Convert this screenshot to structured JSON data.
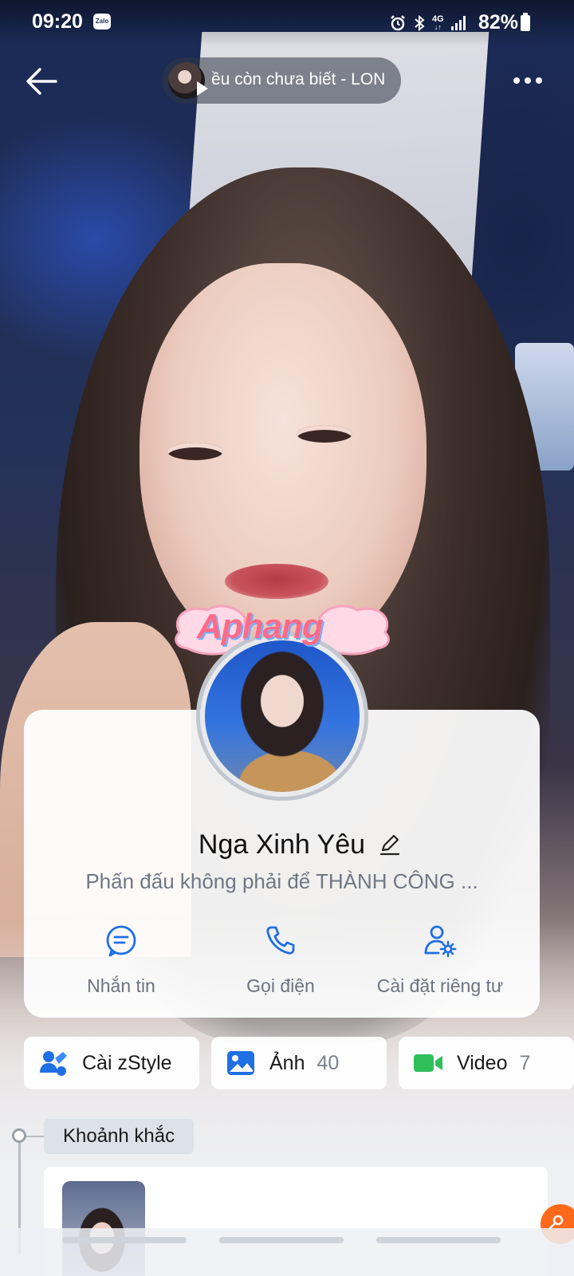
{
  "status_bar": {
    "time": "09:20",
    "app_badge": "Zalo",
    "network": "4G",
    "battery": "82%"
  },
  "top_bar": {
    "music_title": "ều còn chưa biết - LON"
  },
  "profile": {
    "name": "Nga Xinh Yêu",
    "bio": "Phấn đấu không phải để THÀNH CÔNG ...",
    "avatar_frame_text": "Aphang"
  },
  "actions": [
    {
      "label": "Nhắn tin",
      "icon": "message-icon"
    },
    {
      "label": "Gọi điện",
      "icon": "phone-icon"
    },
    {
      "label": "Cài đặt riêng tư",
      "icon": "privacy-settings-icon"
    }
  ],
  "chips": [
    {
      "label": "Cài zStyle",
      "count": "",
      "icon": "zstyle-icon"
    },
    {
      "label": "Ảnh",
      "count": "40",
      "icon": "photo-icon"
    },
    {
      "label": "Video",
      "count": "7",
      "icon": "video-icon"
    }
  ],
  "moments": {
    "label": "Khoảnh khắc"
  },
  "colors": {
    "accent": "#1f6fe5",
    "video": "#2fbf5b",
    "bubble": "#ff6a1a"
  }
}
